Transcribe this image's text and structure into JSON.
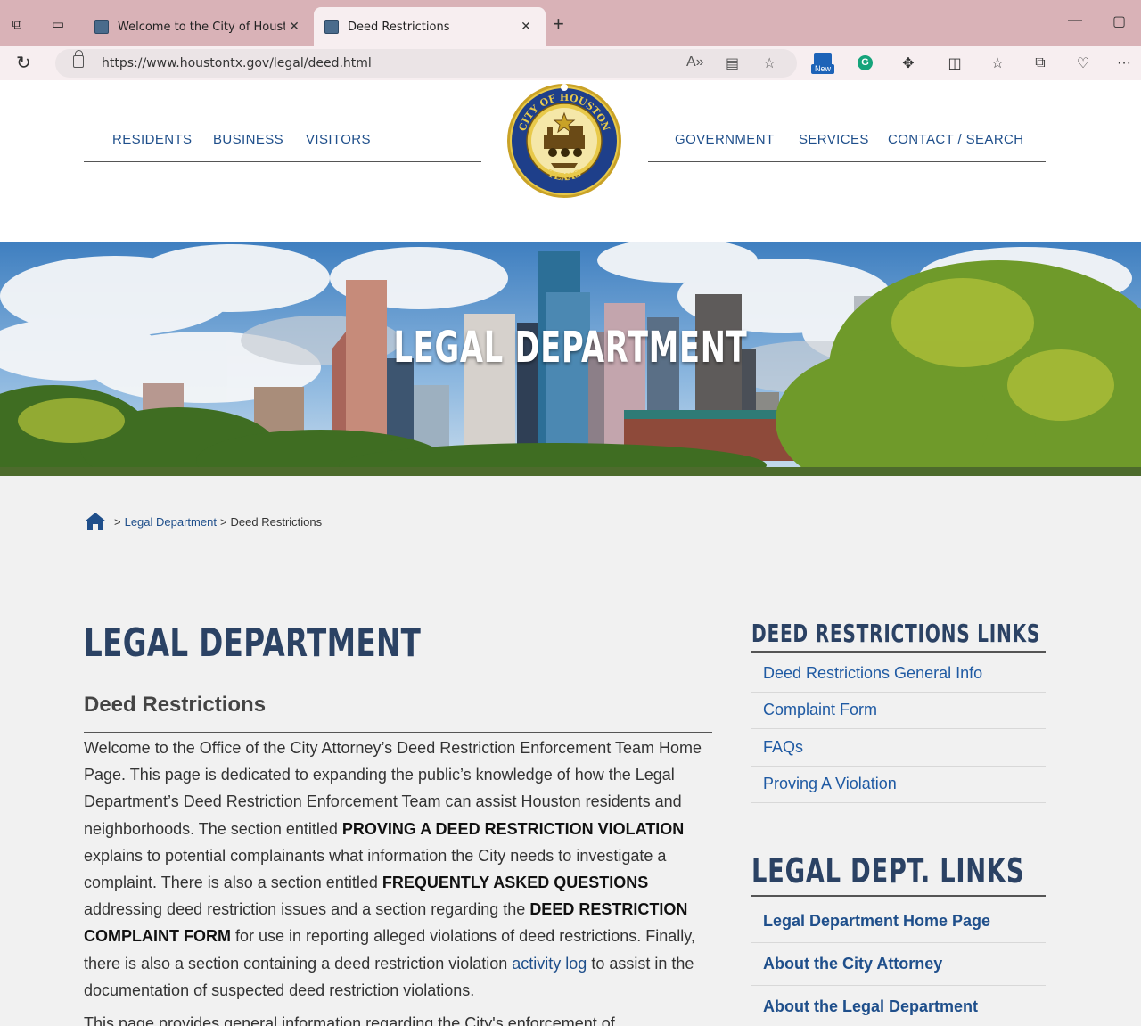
{
  "browser": {
    "tabs": [
      {
        "title": "Welcome to the City of Houston e",
        "active": false
      },
      {
        "title": "Deed Restrictions",
        "active": true
      }
    ],
    "url": "https://www.houstontx.gov/legal/deed.html",
    "new_badge": "New",
    "grammarly": "G"
  },
  "nav": {
    "left": [
      "RESIDENTS",
      "BUSINESS",
      "VISITORS"
    ],
    "right": [
      "GOVERNMENT",
      "SERVICES",
      "CONTACT / SEARCH"
    ]
  },
  "seal": {
    "top_text": "CITY OF HOUSTON",
    "bottom_text": "TEXAS"
  },
  "hero": {
    "title": "LEGAL DEPARTMENT"
  },
  "breadcrumb": {
    "sep": ">",
    "items": [
      "Legal Department",
      "Deed Restrictions"
    ]
  },
  "main": {
    "title": "LEGAL DEPARTMENT",
    "subtitle": "Deed Restrictions",
    "paragraph": [
      {
        "t": "Welcome to the Office of the City Attorney’s Deed Restriction Enforcement Team Home Page.  This page is dedicated to expanding the public’s knowledge of how the Legal Department’s Deed Restriction Enforcement Team can assist Houston residents and neighborhoods.  The section entitled "
      },
      {
        "b": "PROVING A DEED RESTRICTION VIOLATION"
      },
      {
        "t": " explains to potential complainants what information the City needs to investigate a complaint.  There is also a section entitled "
      },
      {
        "b": "FREQUENTLY ASKED QUESTIONS"
      },
      {
        "t": " addressing deed restriction issues and a section regarding the "
      },
      {
        "b": "DEED RESTRICTION COMPLAINT FORM"
      },
      {
        "t": " for use in reporting alleged violations of deed restrictions.  Finally, there is also a section containing a deed restriction violation "
      },
      {
        "a": "activity log"
      },
      {
        "t": " to assist in the documentation of suspected deed restriction violations."
      }
    ],
    "cut_text": "This page provides general information regarding the City's enforcement of"
  },
  "sidebar": {
    "deed_heading": "DEED RESTRICTIONS LINKS",
    "deed_links": [
      "Deed Restrictions General Info",
      "Complaint Form",
      "FAQs",
      "Proving A Violation"
    ],
    "legal_heading": "LEGAL DEPT. LINKS",
    "legal_links": [
      "Legal Department Home Page",
      "About the City Attorney",
      "About the Legal Department"
    ]
  },
  "colors": {
    "tabbar": "#d9b2b7",
    "nav_blue": "#1f4f8b",
    "heading_navy": "#2b4264",
    "link_blue": "#1f5aa3"
  }
}
